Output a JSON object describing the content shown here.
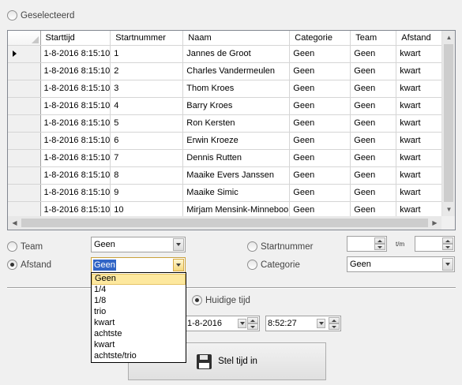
{
  "geselecteerd_label": "Geselecteerd",
  "grid": {
    "columns": [
      "Starttijd",
      "Startnummer",
      "Naam",
      "Categorie",
      "Team",
      "Afstand"
    ],
    "rows": [
      [
        "1-8-2016 8:15:10",
        "1",
        "Jannes de Groot",
        "Geen",
        "Geen",
        "kwart"
      ],
      [
        "1-8-2016 8:15:10",
        "2",
        "Charles Vandermeulen",
        "Geen",
        "Geen",
        "kwart"
      ],
      [
        "1-8-2016 8:15:10",
        "3",
        "Thom Kroes",
        "Geen",
        "Geen",
        "kwart"
      ],
      [
        "1-8-2016 8:15:10",
        "4",
        "Barry Kroes",
        "Geen",
        "Geen",
        "kwart"
      ],
      [
        "1-8-2016 8:15:10",
        "5",
        "Ron Kersten",
        "Geen",
        "Geen",
        "kwart"
      ],
      [
        "1-8-2016 8:15:10",
        "6",
        "Erwin Kroeze",
        "Geen",
        "Geen",
        "kwart"
      ],
      [
        "1-8-2016 8:15:10",
        "7",
        "Dennis Rutten",
        "Geen",
        "Geen",
        "kwart"
      ],
      [
        "1-8-2016 8:15:10",
        "8",
        "Maaike Evers Janssen",
        "Geen",
        "Geen",
        "kwart"
      ],
      [
        "1-8-2016 8:15:10",
        "9",
        "Maaike Simic",
        "Geen",
        "Geen",
        "kwart"
      ],
      [
        "1-8-2016 8:15:10",
        "10",
        "Mirjam Mensink-Minneboo",
        "Geen",
        "Geen",
        "kwart"
      ]
    ],
    "current_row_index": 0
  },
  "filters": {
    "team_label": "Team",
    "team_value": "Geen",
    "afstand_label": "Afstand",
    "afstand_value": "Geen",
    "startnummer_label": "Startnummer",
    "startnummer_from": "",
    "tm_label": "t/m",
    "startnummer_to": "",
    "categorie_label": "Categorie",
    "categorie_value": "Geen"
  },
  "afstand_options": [
    "Geen",
    "1/4",
    "1/8",
    "trio",
    "kwart",
    "achtste",
    "kwart",
    "achtste/trio"
  ],
  "afstand_selected_index": 0,
  "time": {
    "huidige_tijd_label": "Huidige tijd",
    "date_value": "1-8-2016",
    "time_value": "8:52:27"
  },
  "stel_tijd_in_label": "Stel tijd in"
}
